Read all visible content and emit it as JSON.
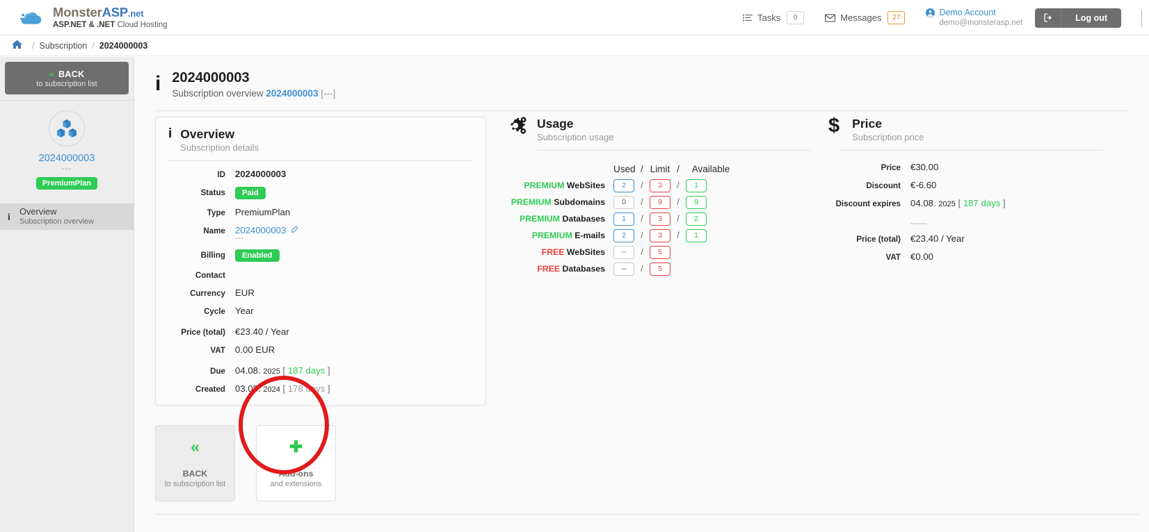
{
  "header": {
    "brand_prefix": "Monster",
    "brand_mid": "ASP",
    "brand_suffix": ".net",
    "brand_tagline_bold": "ASP.NET & .NET",
    "brand_tagline_rest": " Cloud Hosting",
    "tasks_label": "Tasks",
    "tasks_count": "0",
    "tasks_icon": "tasks-icon",
    "messages_label": "Messages",
    "messages_count": "27",
    "messages_icon": "envelope-icon",
    "account_name": "Demo Account",
    "account_email": "demo@monsterasp.net",
    "account_icon": "user-icon",
    "logout_label": "Log out",
    "logout_icon": "logout-icon"
  },
  "breadcrumb": {
    "home_icon": "home-icon",
    "sep": "/",
    "section": "Subscription",
    "current": "2024000003"
  },
  "sidebar": {
    "back_main": "BACK",
    "back_sub": "to subscription list",
    "back_chevron": "«",
    "subscription_icon": "boxes-icon",
    "subscription_id": "2024000003",
    "subscription_dash": "---",
    "plan_badge": "PremiumPlan",
    "nav": [
      {
        "icon": "info-icon",
        "title": "Overview",
        "sub": "Subscription overview"
      }
    ]
  },
  "page": {
    "icon": "info-icon",
    "title": "2024000003",
    "subtitle_prefix": "Subscription overview ",
    "subtitle_link": "2024000003",
    "subtitle_suffix": " [---]"
  },
  "overview": {
    "icon": "info-icon",
    "title": "Overview",
    "subtitle": "Subscription details",
    "rows": [
      {
        "key": "ID",
        "value": "2024000003",
        "kind": "bold"
      },
      {
        "key": "Status",
        "value": "Paid",
        "kind": "pill"
      },
      {
        "key": "Type",
        "value": "PremiumPlan",
        "kind": "text"
      },
      {
        "key": "Name",
        "value": "2024000003",
        "kind": "link-edit",
        "sub": "---"
      },
      {
        "key": "Billing",
        "value": "Enabled",
        "kind": "pill"
      },
      {
        "key": "Contact",
        "value": "",
        "kind": "text"
      },
      {
        "key": "Currency",
        "value": "EUR",
        "kind": "text"
      },
      {
        "key": "Cycle",
        "value": "Year",
        "kind": "text"
      },
      {
        "key": "Price (total)",
        "value": "€23.40 / Year",
        "kind": "text"
      },
      {
        "key": "VAT",
        "value": "0.00 EUR",
        "kind": "text"
      },
      {
        "key": "Due",
        "date": "04.08.",
        "year": "2025",
        "days": "187 days",
        "kind": "date-green"
      },
      {
        "key": "Created",
        "date": "03.08.",
        "year": "2024",
        "days": "178 days",
        "kind": "date-grey"
      }
    ]
  },
  "usage": {
    "icon": "gears-icon",
    "title": "Usage",
    "subtitle": "Subscription usage",
    "columns": [
      "Used",
      "Limit",
      "Available"
    ],
    "col_sep": "/",
    "rows": [
      {
        "tier": "PREMIUM",
        "tier_kind": "prem",
        "name": "WebSites",
        "used": "2",
        "limit": "3",
        "available": "1"
      },
      {
        "tier": "PREMIUM",
        "tier_kind": "prem",
        "name": "Subdomains",
        "used": "0",
        "limit": "9",
        "available": "9",
        "used_plain": true
      },
      {
        "tier": "PREMIUM",
        "tier_kind": "prem",
        "name": "Databases",
        "used": "1",
        "limit": "3",
        "available": "2"
      },
      {
        "tier": "PREMIUM",
        "tier_kind": "prem",
        "name": "E-mails",
        "used": "2",
        "limit": "3",
        "available": "1"
      },
      {
        "tier": "FREE",
        "tier_kind": "free",
        "name": "WebSites",
        "used": "--",
        "limit": "5",
        "available": "",
        "used_plain": true
      },
      {
        "tier": "FREE",
        "tier_kind": "free",
        "name": "Databases",
        "used": "--",
        "limit": "5",
        "available": "",
        "used_plain": true
      }
    ]
  },
  "price": {
    "icon": "dollar-icon",
    "title": "Price",
    "subtitle": "Subscription price",
    "rows": [
      {
        "key": "Price",
        "value": "€30.00",
        "kind": "text"
      },
      {
        "key": "Discount",
        "value": "€-6.60",
        "kind": "text"
      },
      {
        "key": "Discount expires",
        "date": "04.08.",
        "year": "2025",
        "days": "187 days",
        "kind": "date-green"
      },
      {
        "key": "",
        "value": "------",
        "kind": "divider-dash"
      },
      {
        "key": "Price (total)",
        "value": "€23.40 / Year",
        "kind": "text"
      },
      {
        "key": "VAT",
        "value": "€0.00",
        "kind": "text"
      }
    ]
  },
  "tiles": [
    {
      "icon": "chevron-double-left-icon",
      "glyph": "«",
      "label": "BACK",
      "sub": "to subscription list",
      "style": "grey"
    },
    {
      "icon": "plus-icon",
      "glyph": "✚",
      "label": "Add-ons",
      "sub": "and extensions",
      "style": "white"
    }
  ],
  "annotation": {
    "shape": "circle",
    "color": "#e01b1b",
    "target": "add-ons-tile"
  }
}
